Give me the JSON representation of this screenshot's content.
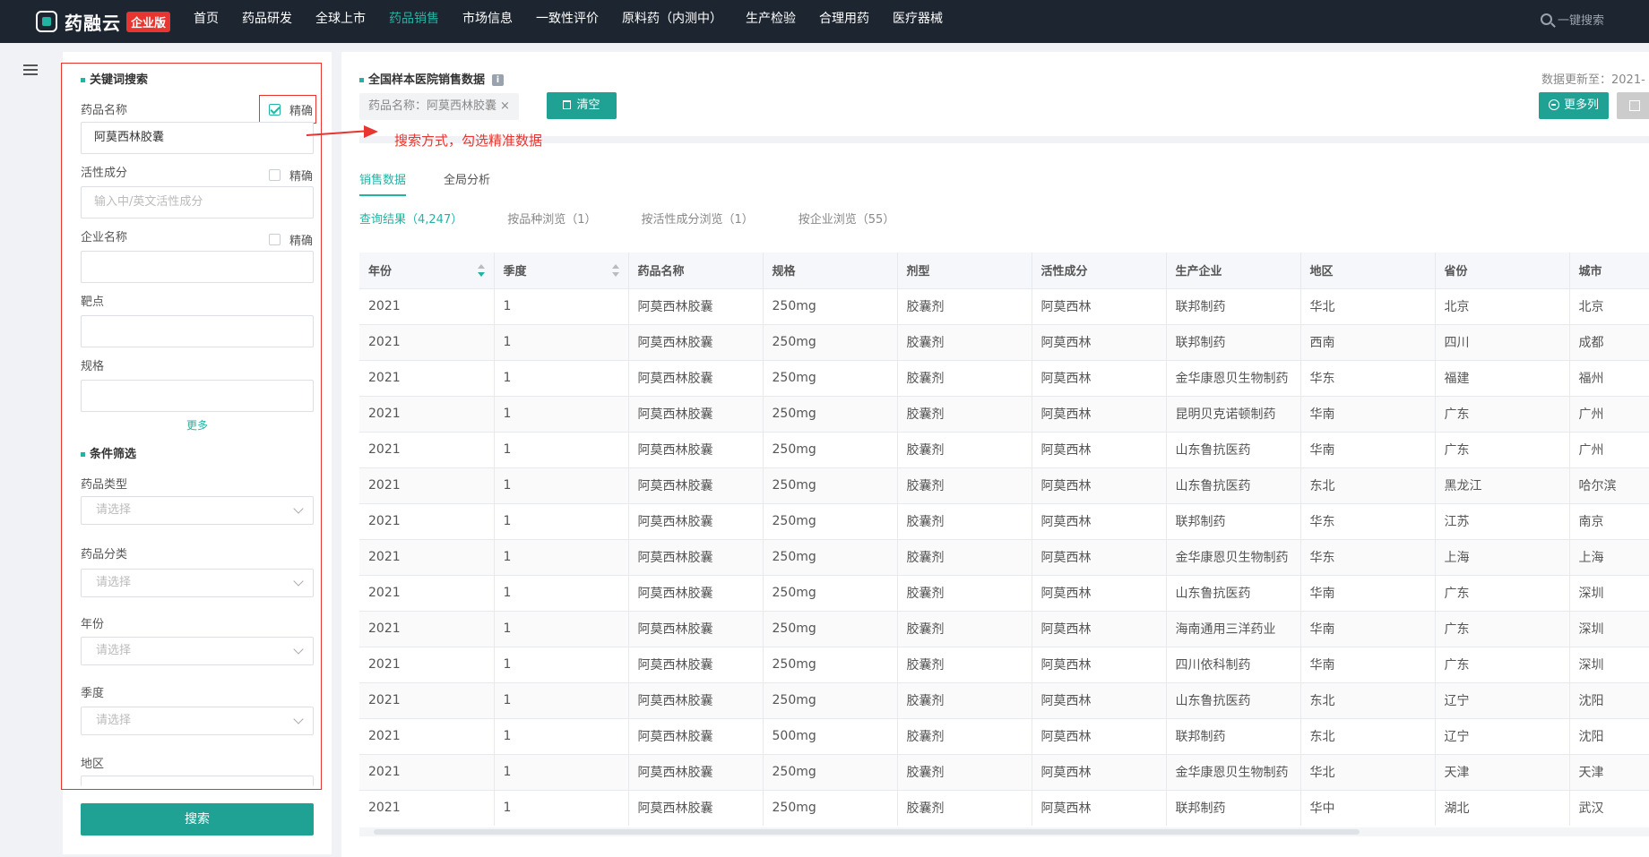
{
  "app": {
    "logo_text": "药融云",
    "badge": "企业版"
  },
  "nav": [
    "首页",
    "药品研发",
    "全球上市",
    "药品销售",
    "市场信息",
    "一致性评价",
    "原料药（内测中）",
    "生产检验",
    "合理用药",
    "医疗器械"
  ],
  "nav_active": "药品销售",
  "top_search_label": "一键搜索",
  "sidebar": {
    "keyword_title": "关键词搜索",
    "drug_name_label": "药品名称",
    "exact_label": "精确",
    "drug_name_value": "阿莫西林胶囊",
    "active_ingredient_label": "活性成分",
    "active_ingredient_placeholder": "输入中/英文活性成分",
    "company_label": "企业名称",
    "target_label": "靶点",
    "spec_label": "规格",
    "more_label": "更多",
    "filter_title": "条件筛选",
    "drug_type_label": "药品类型",
    "drug_class_label": "药品分类",
    "year_label": "年份",
    "quarter_label": "季度",
    "region_label": "地区",
    "select_placeholder": "请选择",
    "search_button": "搜索"
  },
  "annotation": "搜索方式，勾选精准数据",
  "main": {
    "title": "全国样本医院销售数据",
    "update_text": "数据更新至：2021-",
    "tag_text": "药品名称：阿莫西林胶囊",
    "tag_close": "×",
    "clear_button": "清空",
    "more_columns_button": "更多列",
    "tabs": [
      "销售数据",
      "全局分析"
    ],
    "active_tab": "销售数据",
    "subtabs": [
      "查询结果（4,247）",
      "按品种浏览（1）",
      "按活性成分浏览（1）",
      "按企业浏览（55）"
    ],
    "active_subtab": "查询结果（4,247）"
  },
  "table": {
    "columns": [
      "年份",
      "季度",
      "药品名称",
      "规格",
      "剂型",
      "活性成分",
      "生产企业",
      "地区",
      "省份",
      "城市"
    ],
    "rows": [
      [
        "2021",
        "1",
        "阿莫西林胶囊",
        "250mg",
        "胶囊剂",
        "阿莫西林",
        "联邦制药",
        "华北",
        "北京",
        "北京"
      ],
      [
        "2021",
        "1",
        "阿莫西林胶囊",
        "250mg",
        "胶囊剂",
        "阿莫西林",
        "联邦制药",
        "西南",
        "四川",
        "成都"
      ],
      [
        "2021",
        "1",
        "阿莫西林胶囊",
        "250mg",
        "胶囊剂",
        "阿莫西林",
        "金华康恩贝生物制药",
        "华东",
        "福建",
        "福州"
      ],
      [
        "2021",
        "1",
        "阿莫西林胶囊",
        "250mg",
        "胶囊剂",
        "阿莫西林",
        "昆明贝克诺顿制药",
        "华南",
        "广东",
        "广州"
      ],
      [
        "2021",
        "1",
        "阿莫西林胶囊",
        "250mg",
        "胶囊剂",
        "阿莫西林",
        "山东鲁抗医药",
        "华南",
        "广东",
        "广州"
      ],
      [
        "2021",
        "1",
        "阿莫西林胶囊",
        "250mg",
        "胶囊剂",
        "阿莫西林",
        "山东鲁抗医药",
        "东北",
        "黑龙江",
        "哈尔滨"
      ],
      [
        "2021",
        "1",
        "阿莫西林胶囊",
        "250mg",
        "胶囊剂",
        "阿莫西林",
        "联邦制药",
        "华东",
        "江苏",
        "南京"
      ],
      [
        "2021",
        "1",
        "阿莫西林胶囊",
        "250mg",
        "胶囊剂",
        "阿莫西林",
        "金华康恩贝生物制药",
        "华东",
        "上海",
        "上海"
      ],
      [
        "2021",
        "1",
        "阿莫西林胶囊",
        "250mg",
        "胶囊剂",
        "阿莫西林",
        "山东鲁抗医药",
        "华南",
        "广东",
        "深圳"
      ],
      [
        "2021",
        "1",
        "阿莫西林胶囊",
        "250mg",
        "胶囊剂",
        "阿莫西林",
        "海南通用三洋药业",
        "华南",
        "广东",
        "深圳"
      ],
      [
        "2021",
        "1",
        "阿莫西林胶囊",
        "250mg",
        "胶囊剂",
        "阿莫西林",
        "四川依科制药",
        "华南",
        "广东",
        "深圳"
      ],
      [
        "2021",
        "1",
        "阿莫西林胶囊",
        "250mg",
        "胶囊剂",
        "阿莫西林",
        "山东鲁抗医药",
        "东北",
        "辽宁",
        "沈阳"
      ],
      [
        "2021",
        "1",
        "阿莫西林胶囊",
        "500mg",
        "胶囊剂",
        "阿莫西林",
        "联邦制药",
        "东北",
        "辽宁",
        "沈阳"
      ],
      [
        "2021",
        "1",
        "阿莫西林胶囊",
        "250mg",
        "胶囊剂",
        "阿莫西林",
        "金华康恩贝生物制药",
        "华北",
        "天津",
        "天津"
      ],
      [
        "2021",
        "1",
        "阿莫西林胶囊",
        "250mg",
        "胶囊剂",
        "阿莫西林",
        "联邦制药",
        "华中",
        "湖北",
        "武汉"
      ]
    ]
  },
  "colors": {
    "accent": "#23b3a3",
    "annotation_red": "#e8352f",
    "topbar": "#1d2630"
  }
}
